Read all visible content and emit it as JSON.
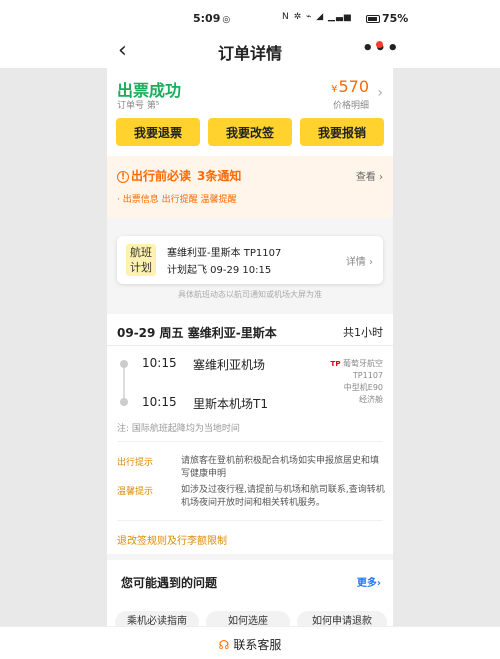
{
  "status_bar": {
    "time": "5:09",
    "time_icon": "◎",
    "icons": "N ✲ ⌁ ◢ ▁▃▅",
    "battery": "75%"
  },
  "nav": {
    "back_icon": "‹",
    "title": "订单详情",
    "more_icon": "•••"
  },
  "order": {
    "status": "出票成功",
    "order_no": "订单号 第⁵",
    "currency": "¥",
    "price": "570",
    "price_detail": "价格明细",
    "arrow": "›"
  },
  "actions": [
    {
      "label": "我要退票"
    },
    {
      "label": "我要改签"
    },
    {
      "label": "我要报销"
    }
  ],
  "notice": {
    "title": "出行前必读",
    "count": "3条通知",
    "view": "查看 ›",
    "items": "· 出票信息 出行提醒 温馨提醒"
  },
  "schedule": {
    "badge": "航班计划",
    "route": "塞维利亚-里斯本 TP1107",
    "planned": "计划起飞 09-29 10:15",
    "detail": "详情 ›",
    "note": "具体航班动态以航司通知或机场大屏为准"
  },
  "flight": {
    "header": "09-29 周五 塞维利亚-里斯本",
    "duration": "共1小时",
    "depart_time": "10:15",
    "depart_airport": "塞维利亚机场",
    "arrive_time": "10:15",
    "arrive_airport": "里斯本机场T1",
    "airline_logo": "TP",
    "airline_name": "葡萄牙航空",
    "flight_no": "TP1107",
    "aircraft": "中型机E90",
    "cabin": "经济舱",
    "note": "注: 国际航班起降均为当地时间",
    "tips": [
      {
        "label": "出行提示",
        "text": "请旅客在登机前积极配合机场如实申报旅居史和填写健康申明"
      },
      {
        "label": "温馨提示",
        "text": "如涉及过夜行程,请提前与机场和航司联系,查询转机机场夜间开放时间和相关转机服务。"
      }
    ]
  },
  "rules_link": "退改签规则及行李额限制",
  "faq": {
    "title": "您可能遇到的问题",
    "more": "更多›",
    "chips": [
      "乘机必读指南",
      "如何选座",
      "如何申请退款"
    ]
  },
  "bottom": {
    "icon": "headset-icon",
    "service": "联系客服"
  },
  "colors": {
    "accent_yellow": "#ffd22e",
    "success_green": "#1aad5c",
    "price_orange": "#ff6a00",
    "link_blue": "#2277ee"
  }
}
